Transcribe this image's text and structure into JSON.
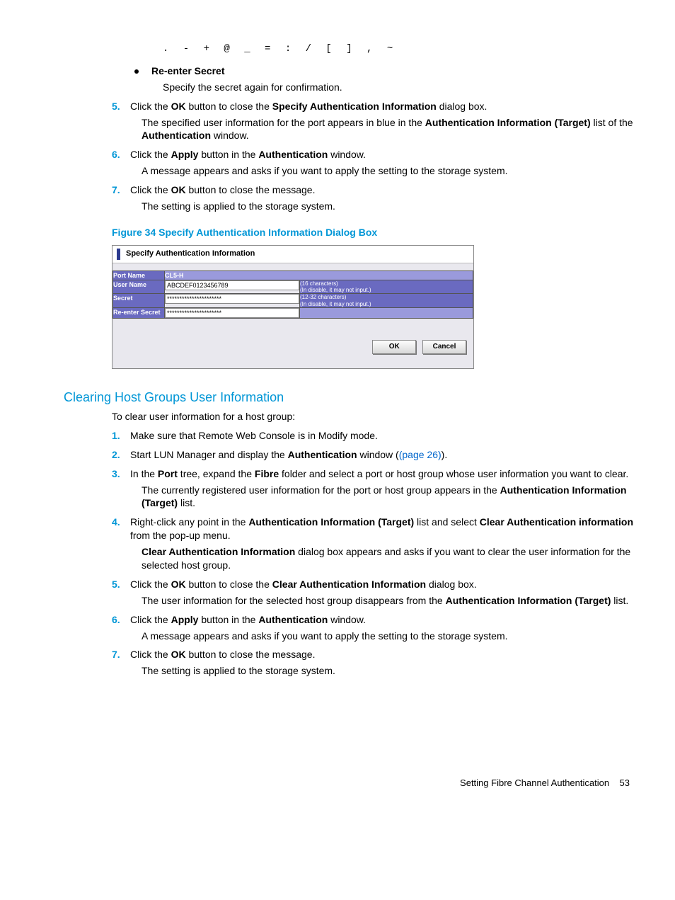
{
  "chars_line": ". - + @ _ = : / [ ] , ~",
  "bullet": {
    "label": "Re-enter Secret",
    "desc": "Specify the secret again for confirmation."
  },
  "top_steps": {
    "s5": {
      "num": "5.",
      "l1a": "Click the ",
      "l1b": "OK",
      "l1c": " button to close the ",
      "l1d": "Specify Authentication Information",
      "l1e": " dialog box.",
      "l2a": "The specified user information for the port appears in blue in the ",
      "l2b": "Authentication Information (Target)",
      "l2c": " list of the ",
      "l2d": "Authentication",
      "l2e": " window."
    },
    "s6": {
      "num": "6.",
      "l1a": "Click the ",
      "l1b": "Apply",
      "l1c": " button in the ",
      "l1d": "Authentication",
      "l1e": " window.",
      "l2": "A message appears and asks if you want to apply the setting to the storage system."
    },
    "s7": {
      "num": "7.",
      "l1a": "Click the ",
      "l1b": "OK",
      "l1c": " button to close the message.",
      "l2": "The setting is applied to the storage system."
    }
  },
  "figure_caption": "Figure 34 Specify Authentication Information Dialog Box",
  "dialog": {
    "title": "Specify Authentication Information",
    "rows": {
      "port_label": "Port Name",
      "port_value": "CL5-H",
      "user_label": "User Name",
      "user_value": "ABCDEF0123456789",
      "user_hint1": "(16 characters)",
      "user_hint2": "(In disable, it may not input.)",
      "secret_label": "Secret",
      "secret_value": "**********************",
      "secret_hint1": "(12-32 characters)",
      "secret_hint2": "(In disable, it may not input.)",
      "re_label": "Re-enter Secret",
      "re_value": "**********************"
    },
    "ok": "OK",
    "cancel": "Cancel"
  },
  "section_heading": "Clearing Host Groups User Information",
  "lead": "To clear user information for a host group:",
  "steps": {
    "s1": {
      "num": "1.",
      "t": "Make sure that Remote Web Console is in Modify mode."
    },
    "s2": {
      "num": "2.",
      "a": "Start LUN Manager and display the ",
      "b": "Authentication",
      "c": " window (",
      "link": "(page 26)",
      "d": ")."
    },
    "s3": {
      "num": "3.",
      "a": "In the ",
      "b": "Port",
      "c": " tree, expand the ",
      "d": "Fibre",
      "e": " folder and select a port or host group whose user information you want to clear.",
      "f1": "The currently registered user information for the port or host group appears in the ",
      "f2": "Authentication Information (Target)",
      "f3": " list."
    },
    "s4": {
      "num": "4.",
      "a": "Right-click any point in the ",
      "b": "Authentication Information (Target)",
      "c": " list and select ",
      "d": "Clear Authentication information",
      "e": " from the pop-up menu.",
      "f1": "Clear Authentication Information",
      "f2": " dialog box appears and asks if you want to clear the user information for the selected host group."
    },
    "s5": {
      "num": "5.",
      "a": "Click the ",
      "b": "OK",
      "c": " button to close the ",
      "d": "Clear Authentication Information",
      "e": " dialog box.",
      "f1": "The user information for the selected host group disappears from the ",
      "f2": "Authentication Information (Target)",
      "f3": " list."
    },
    "s6": {
      "num": "6.",
      "a": "Click the ",
      "b": "Apply",
      "c": " button in the ",
      "d": "Authentication",
      "e": " window.",
      "f": "A message appears and asks if you want to apply the setting to the storage system."
    },
    "s7": {
      "num": "7.",
      "a": "Click the ",
      "b": "OK",
      "c": " button to close the message.",
      "f": "The setting is applied to the storage system."
    }
  },
  "footer": {
    "title": "Setting Fibre Channel Authentication",
    "page": "53"
  }
}
